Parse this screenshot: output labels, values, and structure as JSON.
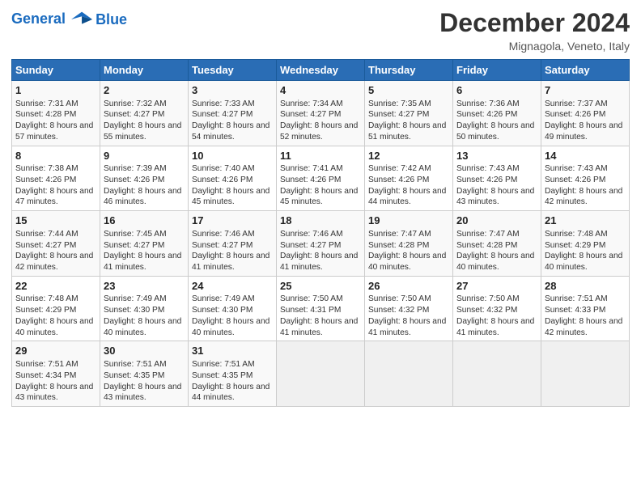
{
  "header": {
    "logo_line1": "General",
    "logo_line2": "Blue",
    "month": "December 2024",
    "location": "Mignagola, Veneto, Italy"
  },
  "weekdays": [
    "Sunday",
    "Monday",
    "Tuesday",
    "Wednesday",
    "Thursday",
    "Friday",
    "Saturday"
  ],
  "weeks": [
    [
      {
        "day": "1",
        "rise": "7:31 AM",
        "set": "4:28 PM",
        "daylight": "8 hours and 57 minutes."
      },
      {
        "day": "2",
        "rise": "7:32 AM",
        "set": "4:27 PM",
        "daylight": "8 hours and 55 minutes."
      },
      {
        "day": "3",
        "rise": "7:33 AM",
        "set": "4:27 PM",
        "daylight": "8 hours and 54 minutes."
      },
      {
        "day": "4",
        "rise": "7:34 AM",
        "set": "4:27 PM",
        "daylight": "8 hours and 52 minutes."
      },
      {
        "day": "5",
        "rise": "7:35 AM",
        "set": "4:27 PM",
        "daylight": "8 hours and 51 minutes."
      },
      {
        "day": "6",
        "rise": "7:36 AM",
        "set": "4:26 PM",
        "daylight": "8 hours and 50 minutes."
      },
      {
        "day": "7",
        "rise": "7:37 AM",
        "set": "4:26 PM",
        "daylight": "8 hours and 49 minutes."
      }
    ],
    [
      {
        "day": "8",
        "rise": "7:38 AM",
        "set": "4:26 PM",
        "daylight": "8 hours and 47 minutes."
      },
      {
        "day": "9",
        "rise": "7:39 AM",
        "set": "4:26 PM",
        "daylight": "8 hours and 46 minutes."
      },
      {
        "day": "10",
        "rise": "7:40 AM",
        "set": "4:26 PM",
        "daylight": "8 hours and 45 minutes."
      },
      {
        "day": "11",
        "rise": "7:41 AM",
        "set": "4:26 PM",
        "daylight": "8 hours and 45 minutes."
      },
      {
        "day": "12",
        "rise": "7:42 AM",
        "set": "4:26 PM",
        "daylight": "8 hours and 44 minutes."
      },
      {
        "day": "13",
        "rise": "7:43 AM",
        "set": "4:26 PM",
        "daylight": "8 hours and 43 minutes."
      },
      {
        "day": "14",
        "rise": "7:43 AM",
        "set": "4:26 PM",
        "daylight": "8 hours and 42 minutes."
      }
    ],
    [
      {
        "day": "15",
        "rise": "7:44 AM",
        "set": "4:27 PM",
        "daylight": "8 hours and 42 minutes."
      },
      {
        "day": "16",
        "rise": "7:45 AM",
        "set": "4:27 PM",
        "daylight": "8 hours and 41 minutes."
      },
      {
        "day": "17",
        "rise": "7:46 AM",
        "set": "4:27 PM",
        "daylight": "8 hours and 41 minutes."
      },
      {
        "day": "18",
        "rise": "7:46 AM",
        "set": "4:27 PM",
        "daylight": "8 hours and 41 minutes."
      },
      {
        "day": "19",
        "rise": "7:47 AM",
        "set": "4:28 PM",
        "daylight": "8 hours and 40 minutes."
      },
      {
        "day": "20",
        "rise": "7:47 AM",
        "set": "4:28 PM",
        "daylight": "8 hours and 40 minutes."
      },
      {
        "day": "21",
        "rise": "7:48 AM",
        "set": "4:29 PM",
        "daylight": "8 hours and 40 minutes."
      }
    ],
    [
      {
        "day": "22",
        "rise": "7:48 AM",
        "set": "4:29 PM",
        "daylight": "8 hours and 40 minutes."
      },
      {
        "day": "23",
        "rise": "7:49 AM",
        "set": "4:30 PM",
        "daylight": "8 hours and 40 minutes."
      },
      {
        "day": "24",
        "rise": "7:49 AM",
        "set": "4:30 PM",
        "daylight": "8 hours and 40 minutes."
      },
      {
        "day": "25",
        "rise": "7:50 AM",
        "set": "4:31 PM",
        "daylight": "8 hours and 41 minutes."
      },
      {
        "day": "26",
        "rise": "7:50 AM",
        "set": "4:32 PM",
        "daylight": "8 hours and 41 minutes."
      },
      {
        "day": "27",
        "rise": "7:50 AM",
        "set": "4:32 PM",
        "daylight": "8 hours and 41 minutes."
      },
      {
        "day": "28",
        "rise": "7:51 AM",
        "set": "4:33 PM",
        "daylight": "8 hours and 42 minutes."
      }
    ],
    [
      {
        "day": "29",
        "rise": "7:51 AM",
        "set": "4:34 PM",
        "daylight": "8 hours and 43 minutes."
      },
      {
        "day": "30",
        "rise": "7:51 AM",
        "set": "4:35 PM",
        "daylight": "8 hours and 43 minutes."
      },
      {
        "day": "31",
        "rise": "7:51 AM",
        "set": "4:35 PM",
        "daylight": "8 hours and 44 minutes."
      },
      null,
      null,
      null,
      null
    ]
  ]
}
